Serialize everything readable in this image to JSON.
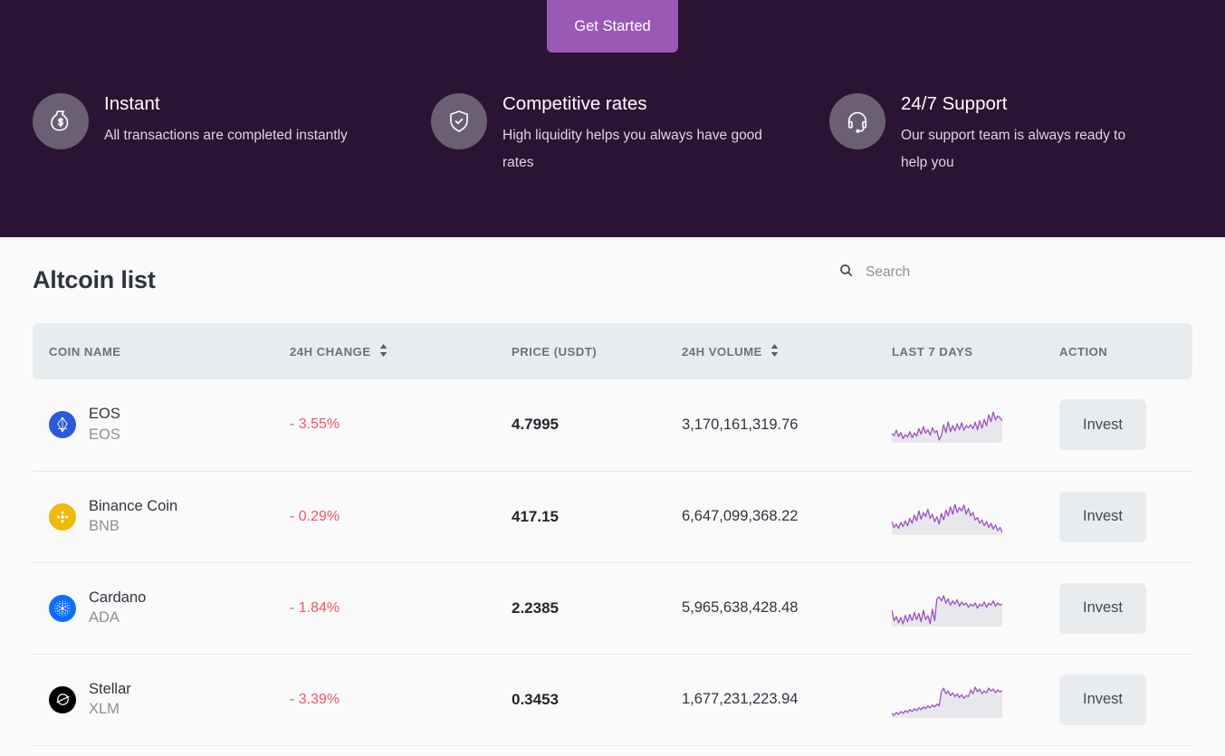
{
  "hero": {
    "background_color": "#2b1333",
    "cta": {
      "label": "Get Started",
      "color": "#9b59b6"
    },
    "features": [
      {
        "icon": "money-bag-icon",
        "title": "Instant",
        "description": "All transactions are completed instantly"
      },
      {
        "icon": "shield-check-icon",
        "title": "Competitive rates",
        "description": "High liquidity helps you always have good rates"
      },
      {
        "icon": "headset-icon",
        "title": "24/7 Support",
        "description": "Our support team is always ready to help you"
      }
    ]
  },
  "main": {
    "title": "Altcoin list",
    "search": {
      "icon": "search-icon",
      "placeholder": "Search",
      "value": ""
    },
    "table": {
      "columns": [
        {
          "label": "COIN NAME",
          "sortable": false
        },
        {
          "label": "24H CHANGE",
          "sortable": true
        },
        {
          "label": "PRICE (USDT)",
          "sortable": false
        },
        {
          "label": "24H VOLUME",
          "sortable": true
        },
        {
          "label": "LAST 7 DAYS",
          "sortable": false
        },
        {
          "label": "ACTION",
          "sortable": false
        }
      ],
      "action_label": "Invest",
      "negative_color": "#ed5565",
      "sparkline_color": "#9b51bf",
      "rows": [
        {
          "logo": "eos-icon",
          "logo_bg": "#2a5ada",
          "name": "EOS",
          "symbol": "EOS",
          "change": "- 3.55%",
          "price": "4.7995",
          "volume": "3,170,161,319.76",
          "sparkline": [
            34,
            30,
            41,
            28,
            36,
            24,
            32,
            27,
            38,
            26,
            35,
            29,
            44,
            33,
            48,
            35,
            42,
            31,
            46,
            36,
            40,
            21,
            30,
            52,
            36,
            58,
            38,
            50,
            40,
            54,
            42,
            56,
            41,
            50,
            46,
            52,
            44,
            57,
            42,
            60,
            45,
            63,
            50,
            72,
            58,
            78,
            62,
            70,
            66,
            60
          ]
        },
        {
          "logo": "bnb-icon",
          "logo_bg": "#f0b90b",
          "name": "Binance Coin",
          "symbol": "BNB",
          "change": "- 0.29%",
          "price": "417.15",
          "volume": "6,647,099,368.22",
          "sparkline": [
            44,
            30,
            38,
            28,
            42,
            32,
            46,
            34,
            52,
            40,
            60,
            46,
            70,
            50,
            66,
            56,
            74,
            52,
            62,
            44,
            56,
            38,
            64,
            48,
            72,
            58,
            80,
            62,
            86,
            66,
            78,
            70,
            84,
            62,
            76,
            58,
            66,
            48,
            54,
            40,
            48,
            34,
            44,
            30,
            40,
            26,
            36,
            22,
            30,
            18
          ]
        },
        {
          "logo": "ada-icon",
          "logo_bg": "#0d6efd",
          "name": "Cardano",
          "symbol": "ADA",
          "change": "- 1.84%",
          "price": "2.2385",
          "volume": "5,965,638,428.48",
          "sparkline": [
            44,
            24,
            32,
            20,
            30,
            18,
            34,
            22,
            36,
            24,
            40,
            26,
            38,
            22,
            44,
            26,
            34,
            18,
            46,
            24,
            66,
            70,
            62,
            72,
            58,
            66,
            54,
            62,
            56,
            64,
            52,
            60,
            54,
            58,
            50,
            56,
            52,
            58,
            48,
            56,
            52,
            60,
            50,
            58,
            54,
            62,
            52,
            58,
            54,
            56
          ]
        },
        {
          "logo": "xlm-icon",
          "logo_bg": "#000000",
          "name": "Stellar",
          "symbol": "XLM",
          "change": "- 3.39%",
          "price": "0.3453",
          "volume": "1,677,231,223.94",
          "sparkline": [
            16,
            12,
            18,
            14,
            20,
            16,
            22,
            18,
            24,
            20,
            26,
            22,
            28,
            24,
            30,
            26,
            32,
            28,
            34,
            30,
            36,
            32,
            62,
            70,
            58,
            64,
            54,
            60,
            52,
            58,
            50,
            56,
            48,
            54,
            52,
            66,
            58,
            72,
            62,
            68,
            58,
            64,
            60,
            70,
            64,
            68,
            60,
            66,
            62,
            64
          ]
        }
      ]
    }
  }
}
